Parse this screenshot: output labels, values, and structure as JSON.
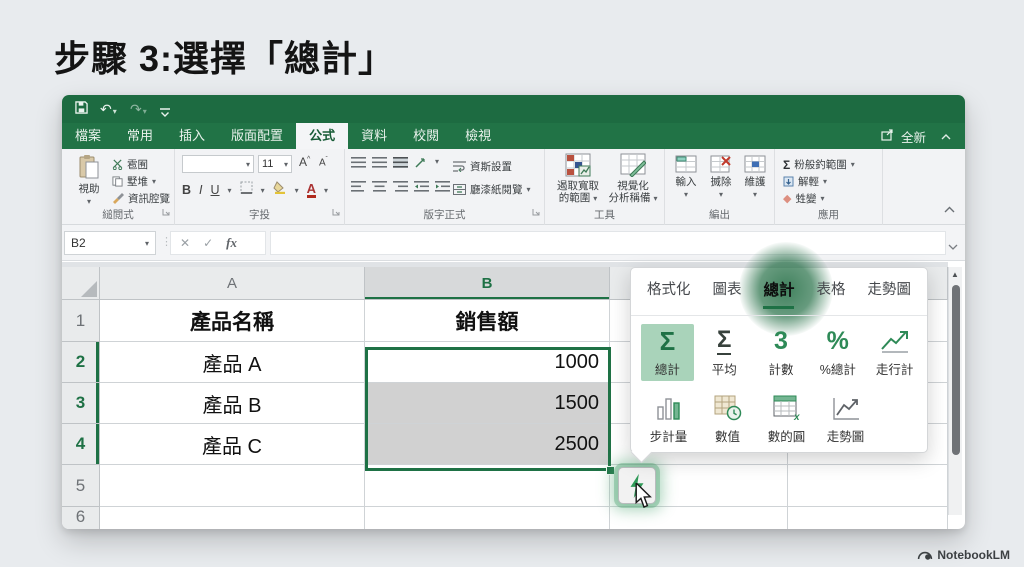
{
  "page": {
    "title": "步驟 3:選擇「總計」",
    "watermark": "NotebookLM"
  },
  "glyphs": {
    "dropdown": "▾",
    "up_arrow": "▲",
    "sigma": "Σ"
  },
  "tabs": {
    "items": [
      {
        "label": "檔案"
      },
      {
        "label": "常用"
      },
      {
        "label": "插入"
      },
      {
        "label": "版面配置"
      },
      {
        "label": "公式"
      },
      {
        "label": "資料"
      },
      {
        "label": "校閱"
      },
      {
        "label": "檢視"
      }
    ],
    "share_label": "全新"
  },
  "ribbon": {
    "clipboard": {
      "paste": "視助",
      "cut": "雹囿",
      "copy": "墅堆",
      "painter": "資訊腔覽",
      "group": "縋閲式"
    },
    "font": {
      "size": "11",
      "bold": "B",
      "italic": "I",
      "underline": "U",
      "grow": "A",
      "shrink": "A",
      "color": "A",
      "group": "字投"
    },
    "align": {
      "wrap": "資斯設置",
      "merge": "廳漆紙閱覽",
      "group": "版字正式"
    },
    "tools": {
      "item1_line1": "遏取寬取",
      "item1_line2": "的範圍",
      "item2_line1": "視覺化",
      "item2_line2": "分析稱備",
      "group": "工具"
    },
    "cells": {
      "insert": "輸入",
      "delete": "搣除",
      "format": "維護",
      "group": "編出"
    },
    "editing": {
      "sum": "粉般釣範圍",
      "fill": "解輕",
      "clear": "甡變",
      "group": "應用"
    }
  },
  "formula_bar": {
    "name_box": "B2",
    "cancel": "✕",
    "confirm": "✓",
    "fx": "fx",
    "value": ""
  },
  "sheet": {
    "cols": [
      "A",
      "B"
    ],
    "rows": [
      {
        "num": "1",
        "a": "產品名稱",
        "b": "銷售額"
      },
      {
        "num": "2",
        "a": "產品 A",
        "b": "1000"
      },
      {
        "num": "3",
        "a": "產品 B",
        "b": "1500"
      },
      {
        "num": "4",
        "a": "產品 C",
        "b": "2500"
      },
      {
        "num": "5",
        "a": "",
        "b": ""
      },
      {
        "num": "6",
        "a": "",
        "b": ""
      }
    ]
  },
  "popup": {
    "tabs": [
      {
        "label": "格式化"
      },
      {
        "label": "圖表"
      },
      {
        "label": "總計"
      },
      {
        "label": "表格"
      },
      {
        "label": "走勢圖"
      }
    ],
    "row1": [
      {
        "glyph": "Σ",
        "label": "總計"
      },
      {
        "glyph": "Σ",
        "label": "平均"
      },
      {
        "glyph": "3",
        "label": "計數"
      },
      {
        "glyph": "%",
        "label": "%總計"
      },
      {
        "label": "走行計"
      }
    ],
    "row2": [
      {
        "label": "步計量"
      },
      {
        "label": "數值"
      },
      {
        "label": "數的圓"
      },
      {
        "label": "走勢圖"
      }
    ]
  },
  "colors": {
    "excel_green": "#217346",
    "selection_border": "#1e7145",
    "selected_fill": "#d1d1d1",
    "item_selected_bg": "#a9d3ba"
  }
}
